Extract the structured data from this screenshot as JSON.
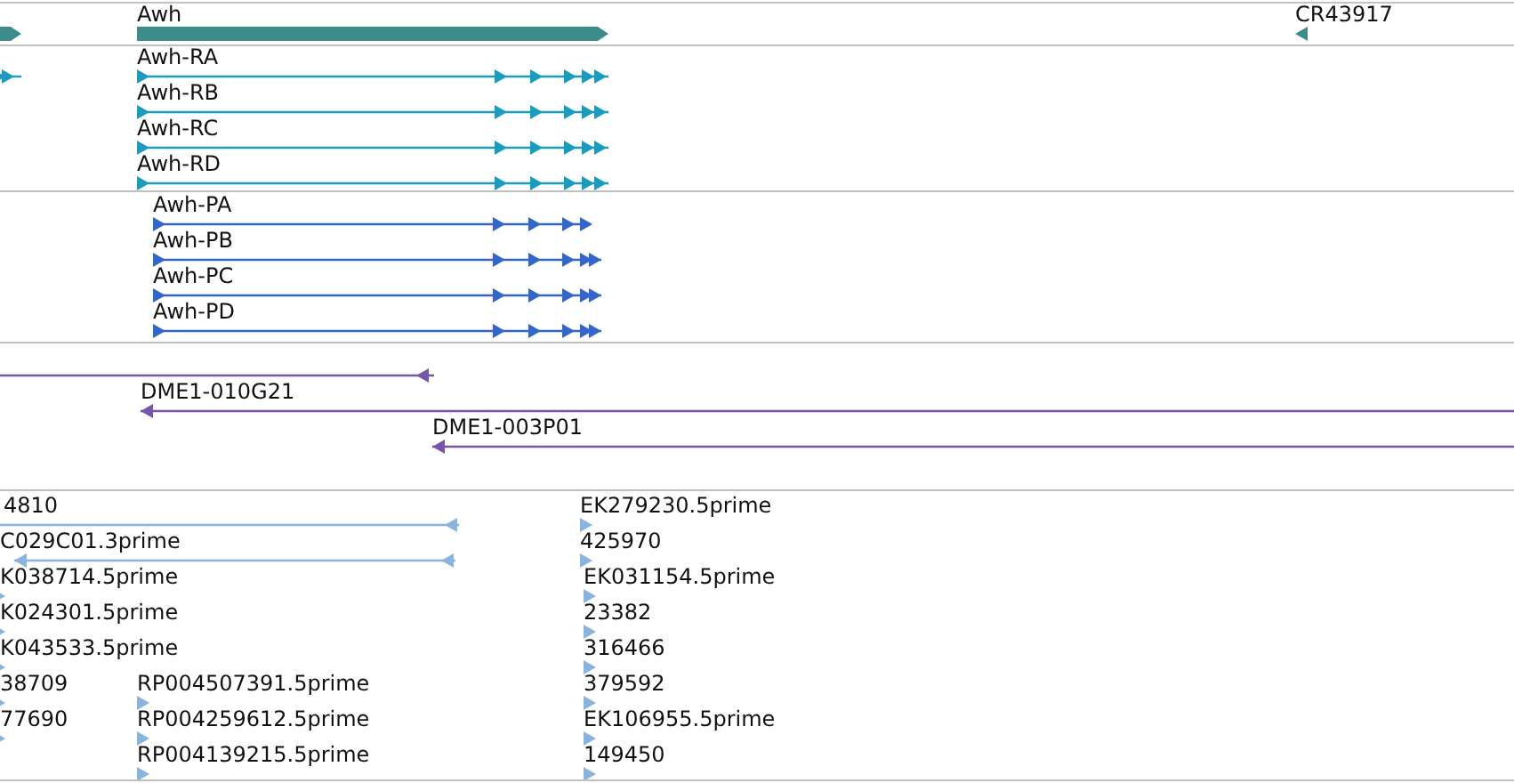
{
  "tracks": [
    {
      "kind": "genes",
      "features": [
        {
          "reverse": false
        },
        {
          "label": "Awh",
          "reverse": false
        },
        {
          "label": "CR43917",
          "reverse": true
        }
      ]
    },
    {
      "kind": "transcripts",
      "features": [
        {
          "reverse": false
        },
        {
          "label": "Awh-RA",
          "reverse": false
        },
        {
          "label": "Awh-RB",
          "reverse": false
        },
        {
          "label": "Awh-RC",
          "reverse": false
        },
        {
          "label": "Awh-RD",
          "reverse": false
        }
      ]
    },
    {
      "kind": "proteins",
      "features": [
        {
          "label": "Awh-PA",
          "reverse": false
        },
        {
          "label": "Awh-PB",
          "reverse": false
        },
        {
          "label": "Awh-PC",
          "reverse": false
        },
        {
          "label": "Awh-PD",
          "reverse": false
        }
      ]
    },
    {
      "kind": "clones",
      "features": [
        {
          "reverse": true
        },
        {
          "label": "DME1-010G21",
          "reverse": true
        },
        {
          "label": "DME1-003P01",
          "reverse": true
        }
      ]
    },
    {
      "kind": "ests",
      "features": [
        {
          "label": "4810",
          "reverse": true
        },
        {
          "label": "C029C01.3prime",
          "reverse": true
        },
        {
          "label": "K038714.5prime",
          "reverse": false
        },
        {
          "label": "K024301.5prime",
          "reverse": false
        },
        {
          "label": "K043533.5prime",
          "reverse": false
        },
        {
          "label": "38709",
          "reverse": false
        },
        {
          "label": "77690",
          "reverse": false
        },
        {
          "label": "RP004507391.5prime",
          "reverse": false
        },
        {
          "label": "RP004259612.5prime",
          "reverse": false
        },
        {
          "label": "RP004139215.5prime",
          "reverse": false
        },
        {
          "label": "EK279230.5prime",
          "reverse": false
        },
        {
          "label": "425970",
          "reverse": false
        },
        {
          "label": "EK031154.5prime",
          "reverse": false
        },
        {
          "label": "23382",
          "reverse": false
        },
        {
          "label": "316466",
          "reverse": false
        },
        {
          "label": "379592",
          "reverse": false
        },
        {
          "label": "EK106955.5prime",
          "reverse": false
        },
        {
          "label": "149450",
          "reverse": false
        }
      ]
    }
  ]
}
